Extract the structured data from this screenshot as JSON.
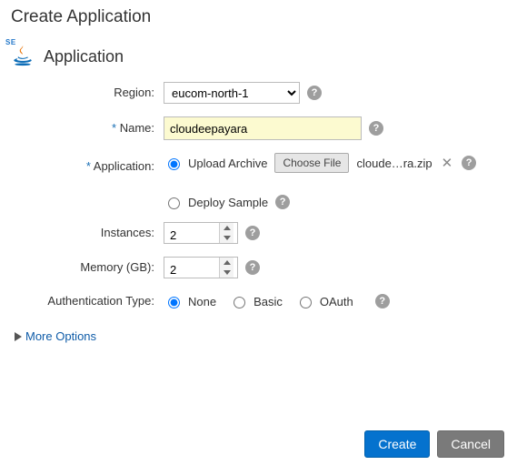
{
  "page": {
    "title": "Create Application"
  },
  "section": {
    "title": "Application",
    "icon_badge": "SE"
  },
  "labels": {
    "region": "Region:",
    "name": "Name:",
    "application": "Application:",
    "instances": "Instances:",
    "memory": "Memory (GB):",
    "auth": "Authentication Type:"
  },
  "region": {
    "value": "eucom-north-1",
    "options": [
      "eucom-north-1"
    ]
  },
  "name": {
    "value": "cloudeepayara"
  },
  "application": {
    "upload_label": "Upload Archive",
    "deploy_label": "Deploy Sample",
    "choose_file_label": "Choose File",
    "file_name": "cloude…ra.zip",
    "selected": "upload"
  },
  "instances": {
    "value": "2"
  },
  "memory": {
    "value": "2"
  },
  "auth": {
    "options": {
      "none": "None",
      "basic": "Basic",
      "oauth": "OAuth"
    },
    "selected": "none"
  },
  "more": {
    "label": "More Options"
  },
  "footer": {
    "create": "Create",
    "cancel": "Cancel"
  },
  "glyphs": {
    "help": "?",
    "remove": "✕"
  }
}
